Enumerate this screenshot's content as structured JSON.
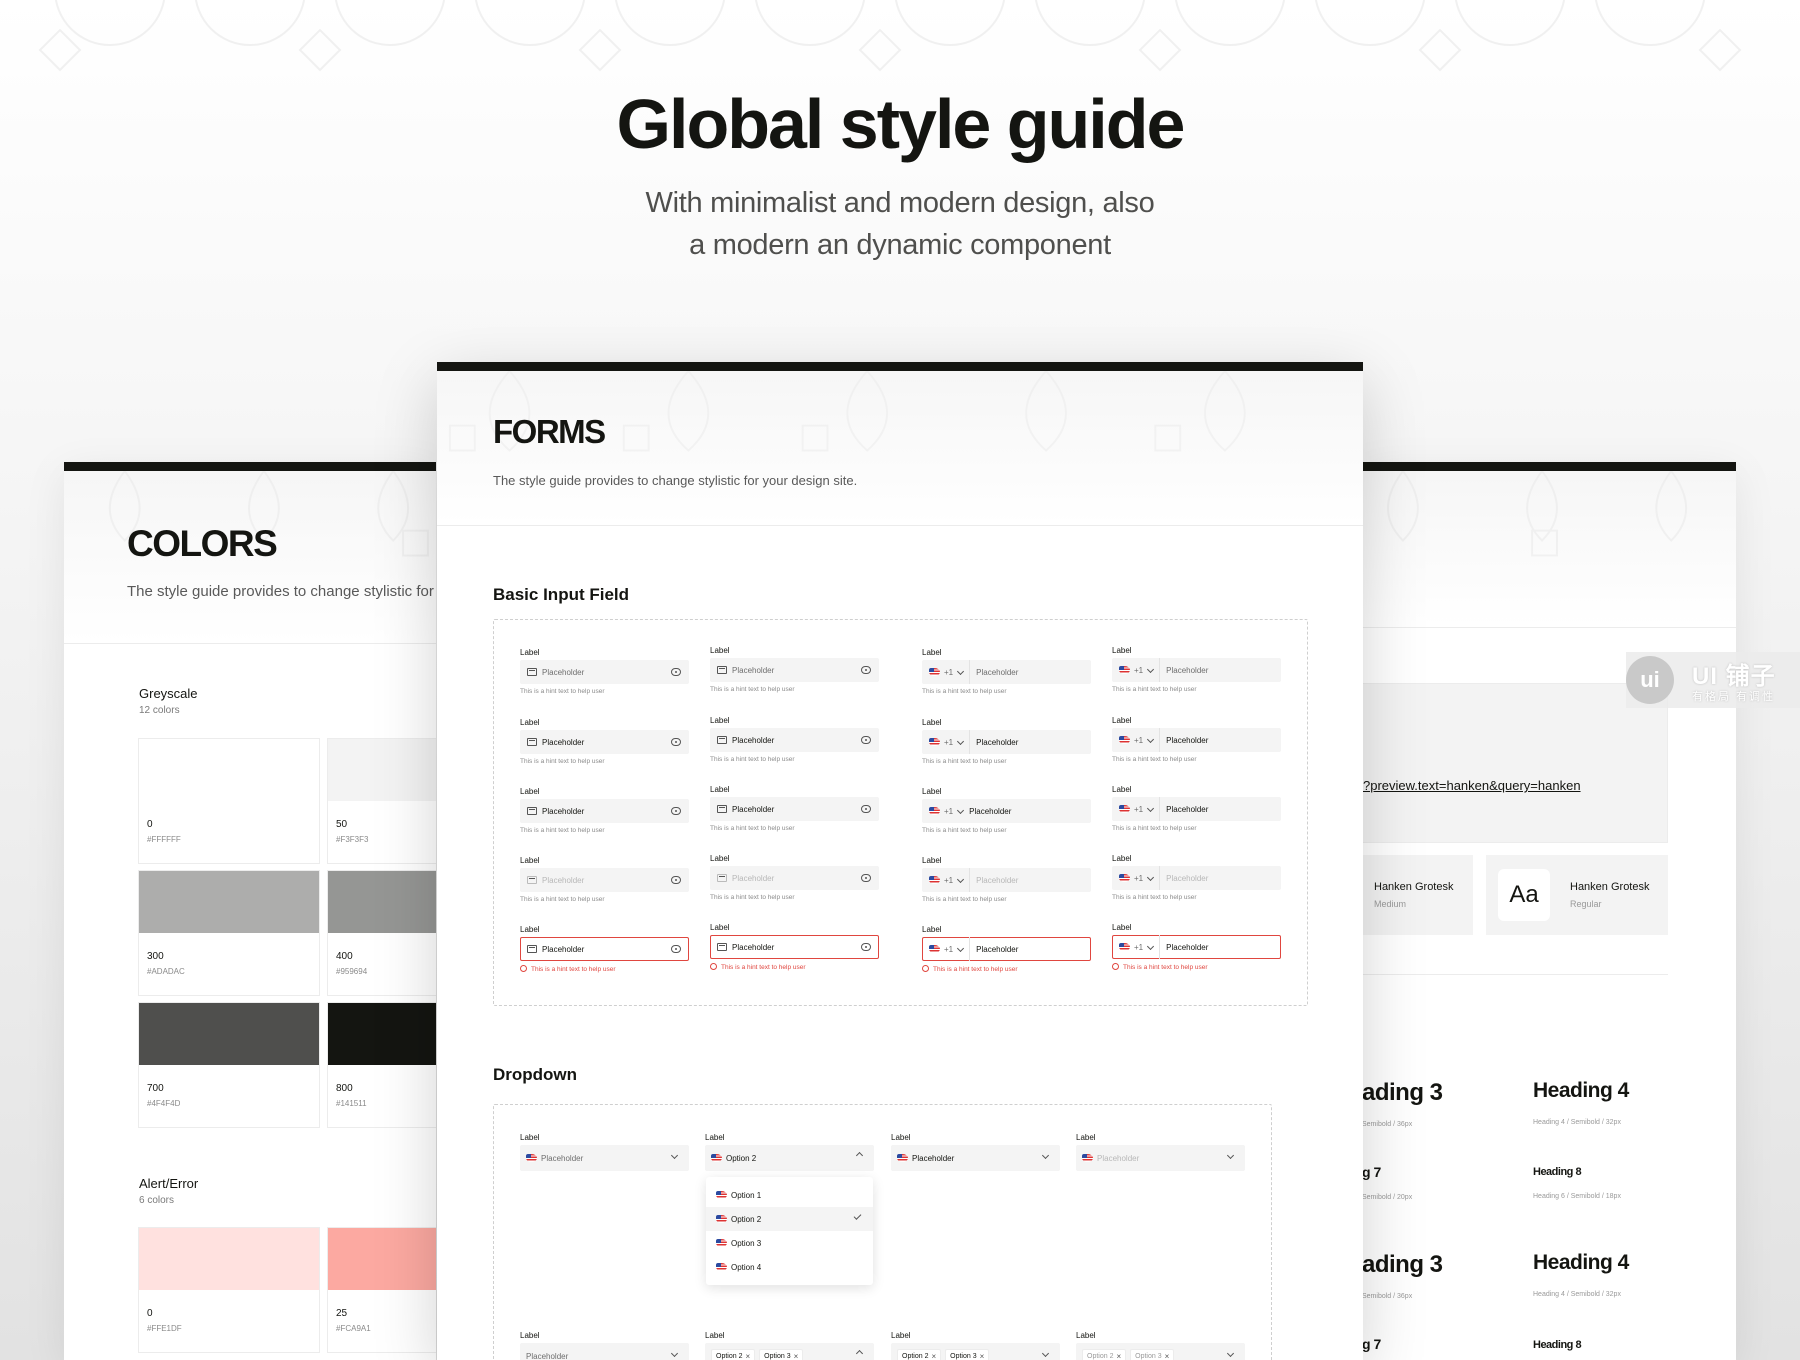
{
  "hero": {
    "title": "Global style guide",
    "subtitle_line1": "With minimalist and modern design, also",
    "subtitle_line2": "a modern an dynamic component"
  },
  "colors_card": {
    "title": "COLORS",
    "description": "The style guide provides to change stylistic for your design site.",
    "greyscale": {
      "title": "Greyscale",
      "count": "12 colors",
      "swatches": [
        {
          "name": "0",
          "hex": "#FFFFFF",
          "color": "#FFFFFF"
        },
        {
          "name": "50",
          "hex": "#F3F3F3",
          "color": "#F3F3F3"
        },
        {
          "name": "300",
          "hex": "#ADADAC",
          "color": "#ADADAC"
        },
        {
          "name": "400",
          "hex": "#959694",
          "color": "#959694"
        },
        {
          "name": "700",
          "hex": "#4F4F4D",
          "color": "#4F4F4D"
        },
        {
          "name": "800",
          "hex": "#141511",
          "color": "#141511"
        }
      ]
    },
    "alert": {
      "title": "Alert/Error",
      "count": "6 colors",
      "swatches": [
        {
          "name": "0",
          "hex": "#FFE1DF",
          "color": "#FFE1DF"
        },
        {
          "name": "25",
          "hex": "#FCA9A1",
          "color": "#FCA9A1"
        }
      ]
    }
  },
  "forms_card": {
    "title": "FORMS",
    "description": "The style guide provides to change stylistic for your design site.",
    "basic_input_title": "Basic Input Field",
    "label": "Label",
    "placeholder": "Placeholder",
    "hint": "This is a hint text to help user",
    "country_code": "+1",
    "dropdown_title": "Dropdown",
    "dropdown_selected": "Option 2",
    "dropdown_options": [
      "Option 1",
      "Option 2",
      "Option 3",
      "Option 4"
    ],
    "chips": [
      "Option 2",
      "Option 3"
    ]
  },
  "typography_card": {
    "url": "?preview.text=hanken&query=hanken",
    "fonts": [
      {
        "name": "Hanken Grotesk",
        "weight": "Medium"
      },
      {
        "name": "Hanken Grotesk",
        "weight": "Regular"
      }
    ],
    "aa": "Aa",
    "headings": [
      {
        "label": "ading 3",
        "meta": "Semibold / 36px"
      },
      {
        "label": "Heading 4",
        "meta": "Heading 4 / Semibold / 32px"
      },
      {
        "label": "g 7",
        "meta": "Semibold / 20px"
      },
      {
        "label": "Heading 8",
        "meta": "Heading 6 / Semibold / 18px"
      },
      {
        "label": "ading 3",
        "meta": "Semibold / 36px"
      },
      {
        "label": "Heading 4",
        "meta": "Heading 4 / Semibold / 32px"
      },
      {
        "label": "g 7",
        "meta": ""
      },
      {
        "label": "Heading 8",
        "meta": ""
      }
    ]
  },
  "watermark": {
    "logo": "ui",
    "brand": "UI 铺子",
    "tagline": "有格局 有调性"
  }
}
